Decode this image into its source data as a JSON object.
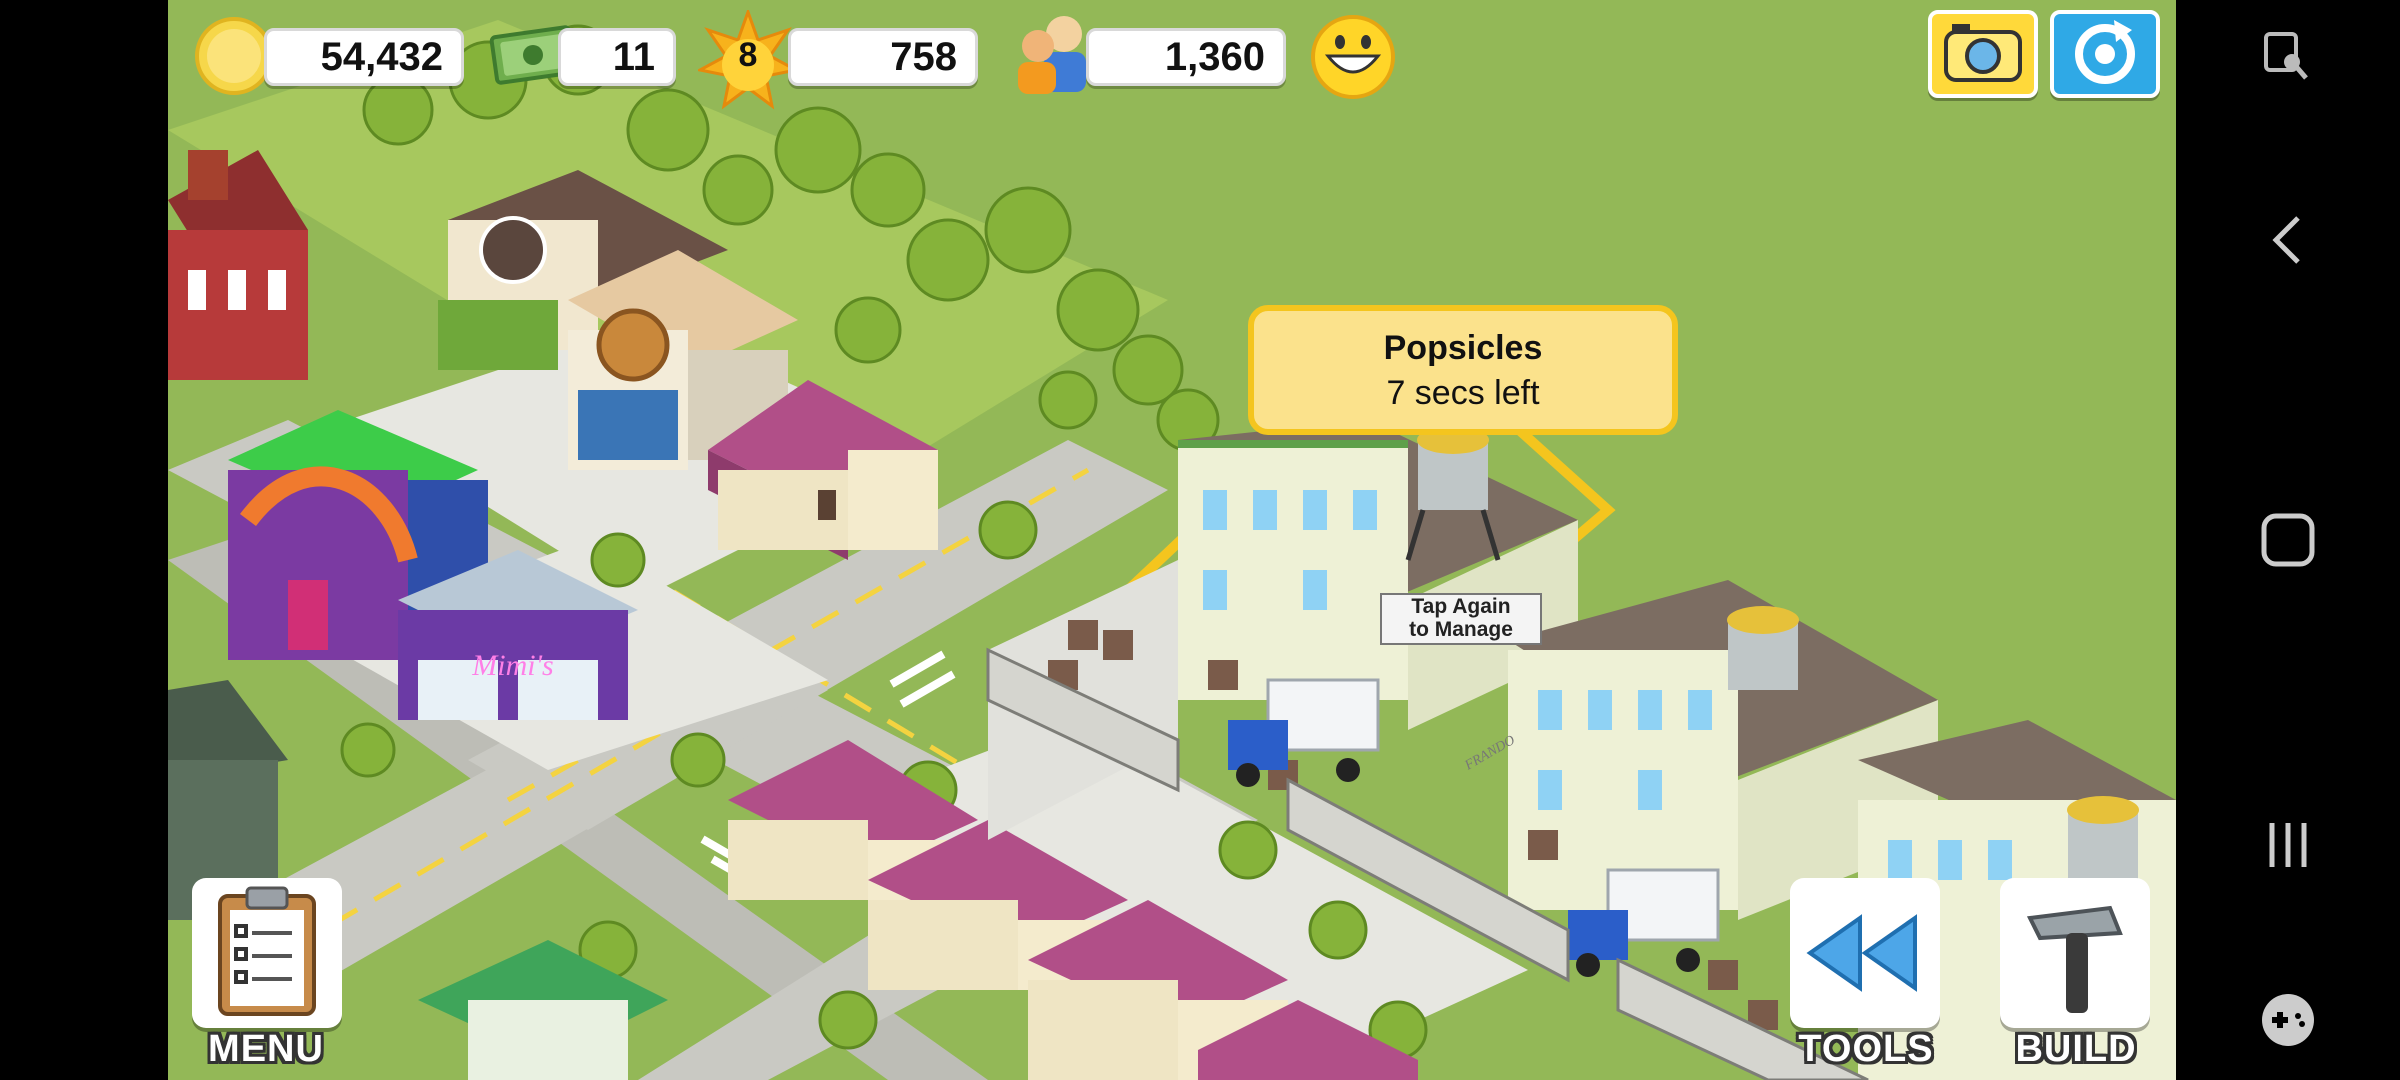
{
  "hud": {
    "coins": "54,432",
    "cash": "11",
    "level": "8",
    "xp": "758",
    "population": "1,360"
  },
  "tooltip": {
    "title": "Popsicles",
    "subtitle": "7 secs left"
  },
  "sign": {
    "line1": "Tap Again",
    "line2": "to Manage"
  },
  "storefront": {
    "mimis": "Mimi's",
    "frando": "FRANDO"
  },
  "buttons": {
    "menu": "MENU",
    "tools": "TOOLS",
    "build": "BUILD"
  },
  "icons": {
    "coin": "coin-icon",
    "cash": "cash-icon",
    "level": "star-icon",
    "population": "people-icon",
    "happiness": "smiley-icon",
    "camera": "camera-icon",
    "social": "refresh-icon"
  },
  "colors": {
    "grass": "#93b857",
    "tooltip_bg": "#fbe28c",
    "tooltip_border": "#f4c51e",
    "roof_pink": "#a14a7e",
    "factory_wall": "#eef1d6"
  }
}
